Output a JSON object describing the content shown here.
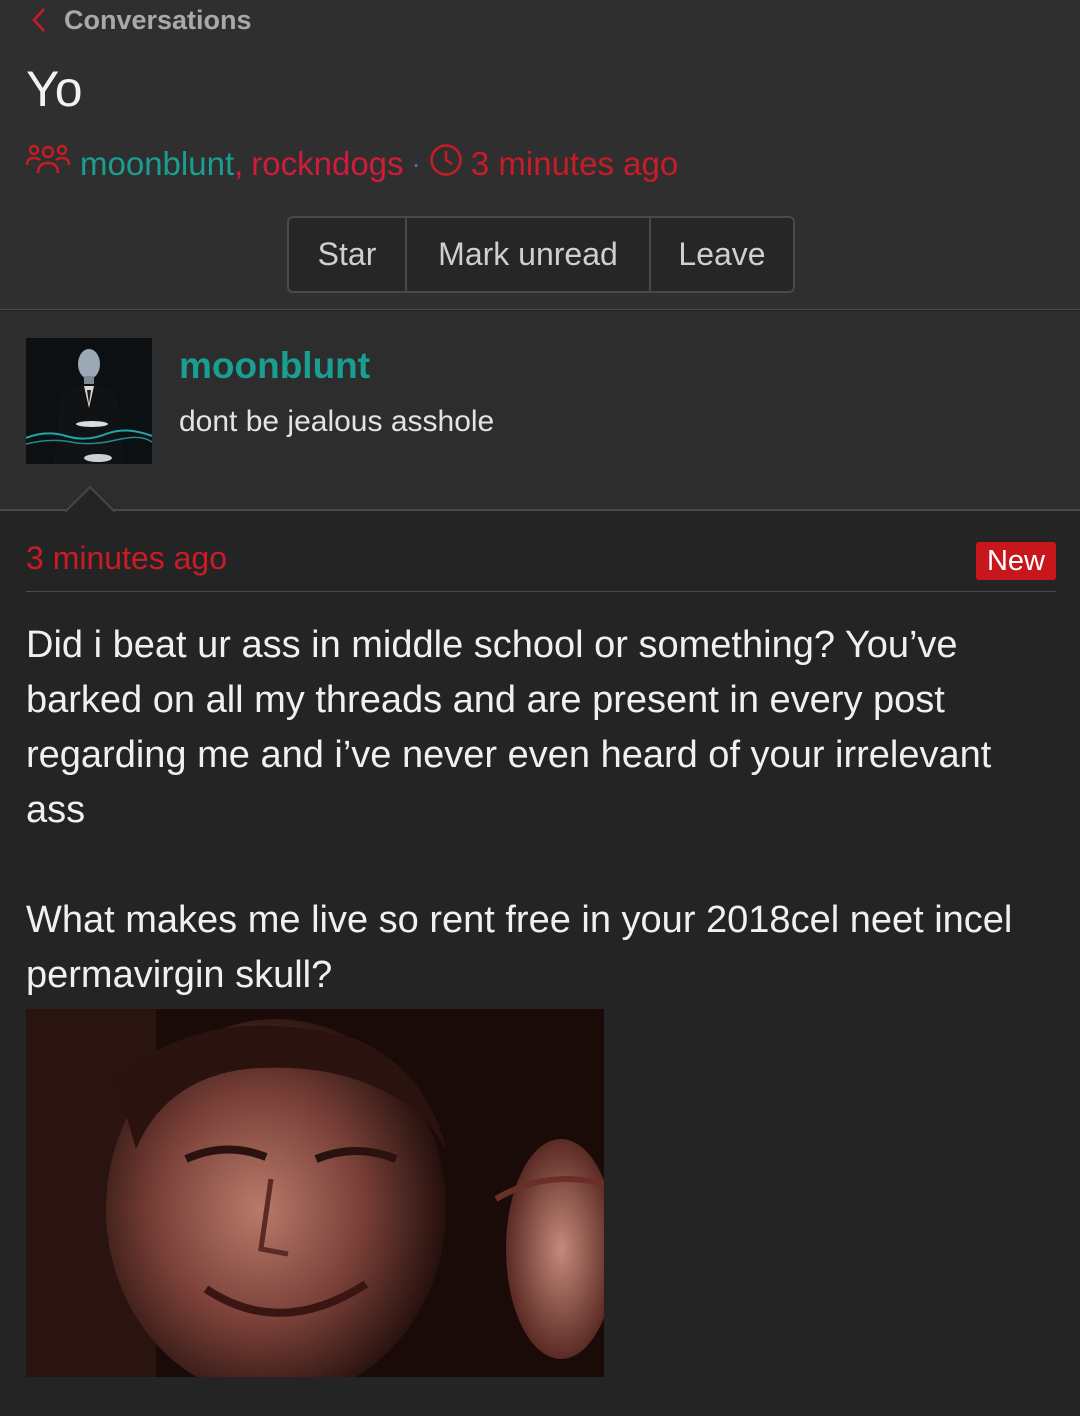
{
  "breadcrumb": {
    "label": "Conversations",
    "icon": "chevron-left-icon"
  },
  "conversation": {
    "title": "Yo",
    "participants": [
      "moonblunt",
      "rockndogs"
    ],
    "separator_comma": ",",
    "separator_dot": "·",
    "time": "3 minutes ago"
  },
  "actions": {
    "star": "Star",
    "mark_unread": "Mark unread",
    "leave": "Leave"
  },
  "preview": {
    "author": "moonblunt",
    "text": "dont be jealous asshole"
  },
  "message": {
    "time": "3 minutes ago",
    "badge": "New",
    "paragraph_1": "Did i beat ur ass in middle school or something? You’ve barked on all my threads and are present in every post regarding me and i’ve never even heard of your irrelevant ass",
    "paragraph_2": "What makes me live so rent free in your 2018cel neet incel permavirgin skull?"
  },
  "colors": {
    "accent_teal": "#1b9e92",
    "accent_red": "#c81c26",
    "badge_red": "#c8161d",
    "background": "#242424",
    "header_bg": "#2f2f2f"
  }
}
